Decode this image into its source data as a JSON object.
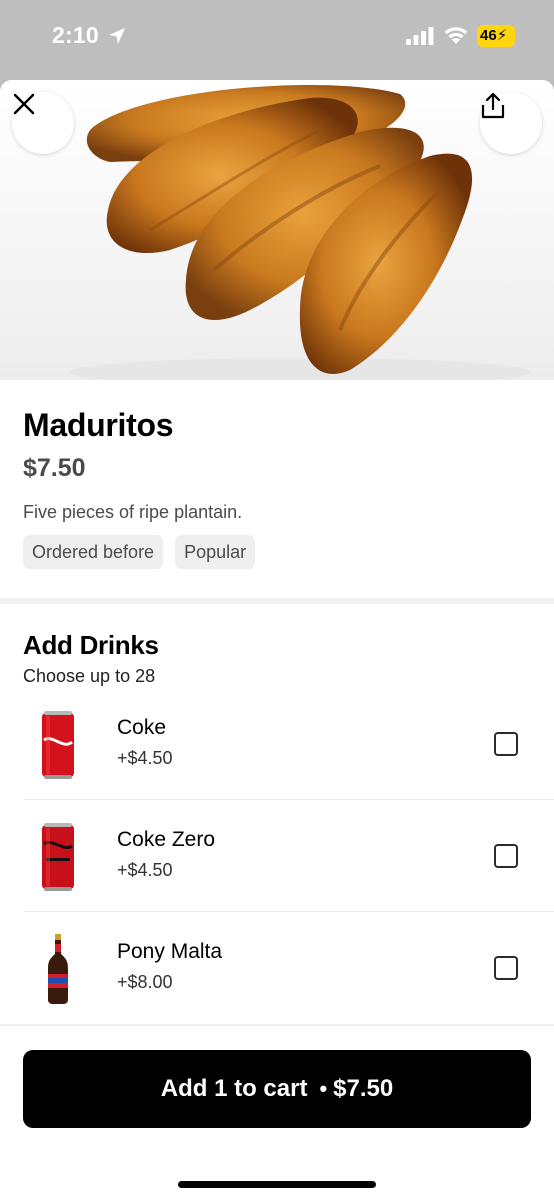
{
  "status_bar": {
    "time": "2:10",
    "battery": "46"
  },
  "item": {
    "title": "Maduritos",
    "price": "$7.50",
    "description": "Five pieces of ripe plantain.",
    "badges": [
      "Ordered before",
      "Popular"
    ]
  },
  "drinks": {
    "title": "Add Drinks",
    "subtitle": "Choose up to 28",
    "options": [
      {
        "name": "Coke",
        "price": "+$4.50"
      },
      {
        "name": "Coke Zero",
        "price": "+$4.50"
      },
      {
        "name": "Pony Malta",
        "price": "+$8.00"
      }
    ]
  },
  "cart": {
    "label": "Add 1 to cart",
    "dot": "•",
    "total": "$7.50"
  },
  "colors": {
    "button_bg": "#000000",
    "badge_bg": "#efefef",
    "battery": "#ffd60a"
  }
}
